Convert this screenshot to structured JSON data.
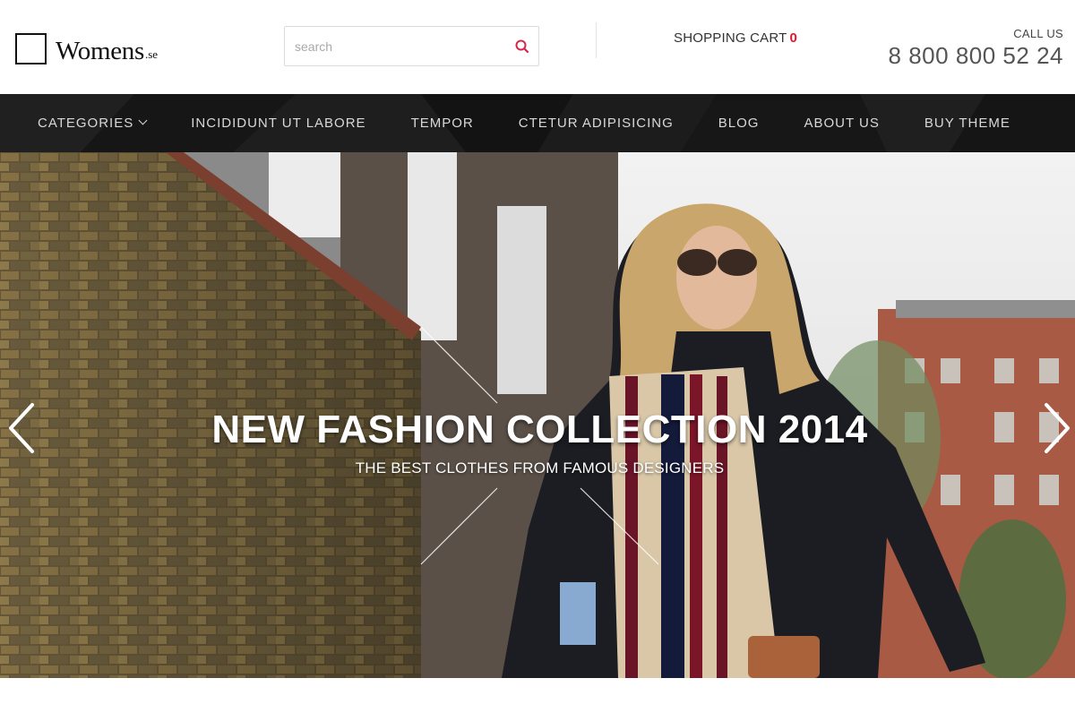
{
  "header": {
    "logo": {
      "name": "Womens",
      "tld": ".se"
    },
    "search": {
      "placeholder": "search",
      "value": ""
    },
    "cart": {
      "label": "SHOPPING CART",
      "count": "0"
    },
    "call": {
      "label": "CALL US",
      "number": "8 800 800 52 24"
    }
  },
  "nav": {
    "items": [
      {
        "label": "CATEGORIES",
        "has_dropdown": true
      },
      {
        "label": "INCIDIDUNT UT LABORE"
      },
      {
        "label": "TEMPOR"
      },
      {
        "label": "CTETUR ADIPISICING"
      },
      {
        "label": "BLOG"
      },
      {
        "label": "ABOUT US"
      },
      {
        "label": "BUY THEME"
      }
    ]
  },
  "hero": {
    "title": "NEW FASHION COLLECTION 2014",
    "subtitle": "THE BEST CLOTHES FROM FAMOUS DESIGNERS"
  },
  "colors": {
    "accent": "#e0182d",
    "nav_bg": "#1a1a1a",
    "nav_text": "#d8d8d8"
  },
  "icons": [
    "search-icon",
    "chevron-down-icon",
    "chevron-left-icon",
    "chevron-right-icon"
  ]
}
